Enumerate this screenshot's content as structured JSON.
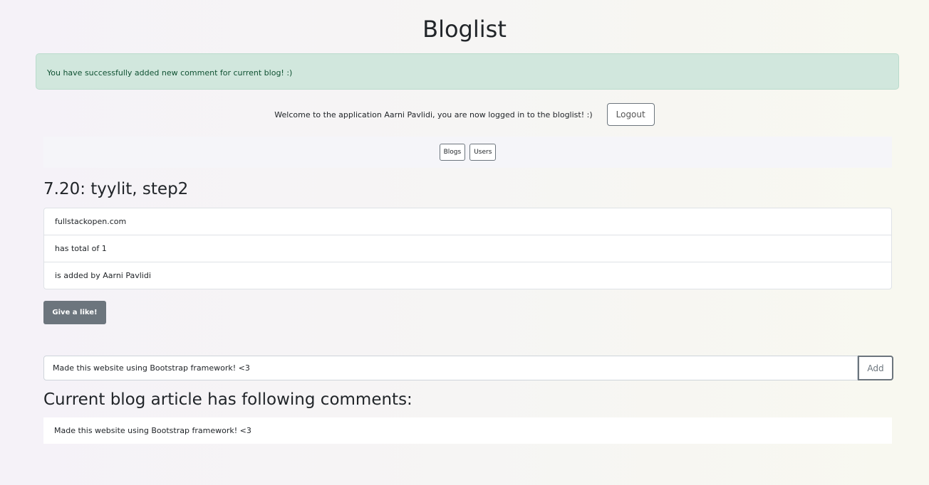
{
  "header": {
    "title": "Bloglist"
  },
  "notification": {
    "message": "You have successfully added new comment for current blog! :)"
  },
  "session": {
    "welcome_text": "Welcome to the application Aarni Pavlidi, you are now logged in to the bloglist! :)",
    "logout_label": "Logout"
  },
  "nav": {
    "items": [
      {
        "label": "Blogs"
      },
      {
        "label": "Users"
      }
    ]
  },
  "blog": {
    "title": "7.20: tyylit, step2",
    "details": [
      "fullstackopen.com",
      "has total of 1",
      "is added by Aarni Pavlidi"
    ],
    "like_label": "Give a like!"
  },
  "comment_form": {
    "value": "Made this website using Bootstrap framework! <3",
    "add_label": "Add"
  },
  "comments": {
    "heading": "Current blog article has following comments:",
    "items": [
      "Made this website using Bootstrap framework! <3"
    ]
  },
  "colors": {
    "alert_bg": "#d1e7dd",
    "alert_text": "#0f5132",
    "like_button_bg": "#6c757d"
  }
}
